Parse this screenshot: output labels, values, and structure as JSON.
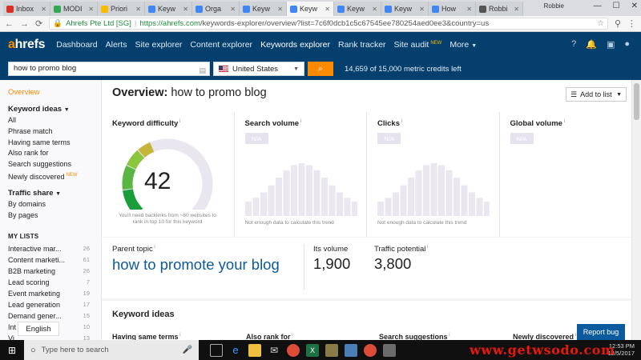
{
  "browser": {
    "tabs": [
      {
        "label": "Inbox",
        "color": "#d93025",
        "active": false
      },
      {
        "label": "MODI",
        "color": "#34a853",
        "active": false
      },
      {
        "label": "Priori",
        "color": "#fbbc04",
        "active": false
      },
      {
        "label": "Keyw",
        "color": "#4285f4",
        "active": false
      },
      {
        "label": "Orga",
        "color": "#4285f4",
        "active": false
      },
      {
        "label": "Keyw",
        "color": "#4285f4",
        "active": false
      },
      {
        "label": "Keyw",
        "color": "#4285f4",
        "active": true
      },
      {
        "label": "Keyw",
        "color": "#4285f4",
        "active": false
      },
      {
        "label": "Keyw",
        "color": "#4285f4",
        "active": false
      },
      {
        "label": "How",
        "color": "#4285f4",
        "active": false
      },
      {
        "label": "Robbi",
        "color": "#555555",
        "active": false
      }
    ],
    "user": "Robbie",
    "secure_label": "Ahrefs Pte Ltd [SG]",
    "url_host": "https://ahrefs.com",
    "url_path": "/keywords-explorer/overview?list=7c6f0dcb1c5c67545ee780254aed0ee3&country=us"
  },
  "nav": {
    "logo_a": "a",
    "logo_rest": "hrefs",
    "items": [
      "Dashboard",
      "Alerts",
      "Site explorer",
      "Content explorer",
      "Keywords explorer",
      "Rank tracker",
      "Site audit",
      "More"
    ],
    "new_label": "NEW"
  },
  "search": {
    "keyword": "how to promo blog",
    "country": "United States",
    "credits": "14,659 of 15,000 metric credits left"
  },
  "sidebar": {
    "overview": "Overview",
    "keyword_ideas": "Keyword ideas",
    "ki_items": [
      "All",
      "Phrase match",
      "Having same terms",
      "Also rank for",
      "Search suggestions",
      "Newly discovered"
    ],
    "new_label": "NEW",
    "traffic_share": "Traffic share",
    "ts_items": [
      "By domains",
      "By pages"
    ],
    "my_lists": "MY LISTS",
    "lists": [
      {
        "name": "Interactive mar...",
        "count": "26"
      },
      {
        "name": "Content marketi...",
        "count": "61"
      },
      {
        "name": "B2B marketing",
        "count": "26"
      },
      {
        "name": "Lead scoring",
        "count": "7"
      },
      {
        "name": "Event marketing",
        "count": "19"
      },
      {
        "name": "Lead generation",
        "count": "17"
      },
      {
        "name": "Demand gener...",
        "count": "15"
      },
      {
        "name": "Int",
        "count": "10"
      },
      {
        "name": "Vi",
        "count": "13"
      }
    ],
    "language": "English"
  },
  "overview": {
    "title_bold": "Overview:",
    "title_keyword": "how to promo blog",
    "add_to_list": "Add to list",
    "kd_label": "Keyword difficulty",
    "kd_value": "42",
    "kd_fraction": 0.42,
    "kd_note": "You'll need backlinks from ~60 websites to rank in top 10 for this keyword",
    "search_volume_label": "Search volume",
    "clicks_label": "Clicks",
    "global_volume_label": "Global volume",
    "na": "N/A",
    "not_enough": "Not enough data to calculate this trend",
    "parent_topic_label": "Parent topic",
    "parent_topic": "how to promote your blog",
    "its_volume_label": "Its volume",
    "its_volume": "1,900",
    "traffic_potential_label": "Traffic potential",
    "traffic_potential": "3,800"
  },
  "keyword_ideas": {
    "title": "Keyword ideas",
    "cols": [
      "Having same terms",
      "Also rank for",
      "Search suggestions",
      "Newly discovered"
    ],
    "report_bug": "Report bug"
  },
  "taskbar": {
    "search_placeholder": "Type here to search",
    "time": "12:53 PM",
    "date": "12/5/2017"
  },
  "watermark": "www.getwsodo.com",
  "colors": {
    "accent": "#ff8a00",
    "nav_bg": "#053f6e",
    "link": "#0b5a9e",
    "watermark": "#e8190b"
  }
}
